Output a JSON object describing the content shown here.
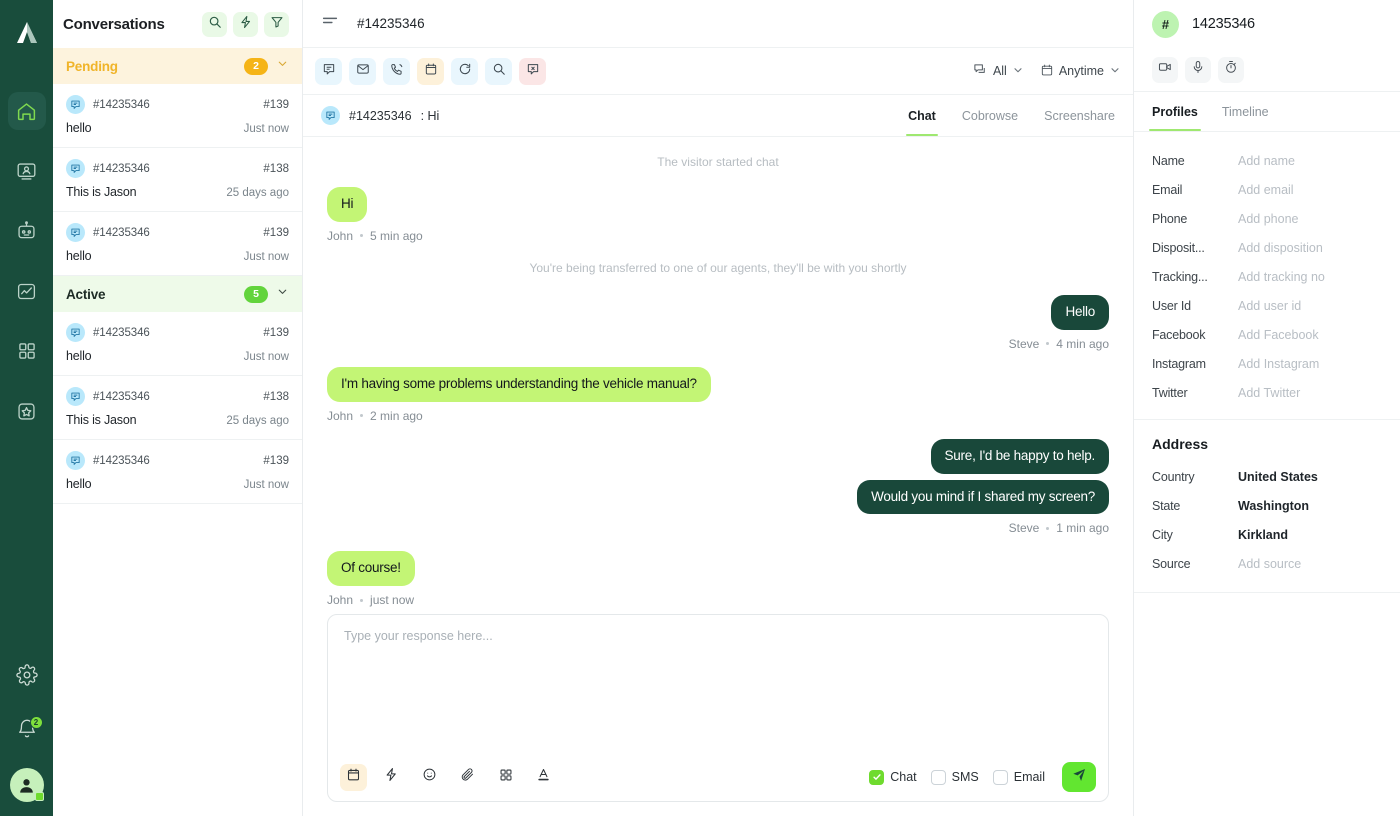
{
  "rail": {
    "logo_icon": "brand-logo-icon",
    "nav": [
      {
        "name": "home",
        "icon": "home-icon",
        "active": true
      },
      {
        "name": "visitors",
        "icon": "monitor-person-icon",
        "active": false
      },
      {
        "name": "bots",
        "icon": "robot-icon",
        "active": false
      },
      {
        "name": "analytics",
        "icon": "analytics-chart-icon",
        "active": false
      },
      {
        "name": "apps",
        "icon": "grid-apps-icon",
        "active": false
      },
      {
        "name": "favorites",
        "icon": "star-box-icon",
        "active": false
      }
    ],
    "bottom": [
      {
        "name": "settings",
        "icon": "gear-icon"
      },
      {
        "name": "notifications",
        "icon": "bell-icon",
        "badge": "2"
      },
      {
        "name": "profile",
        "icon": "user-avatar-icon"
      }
    ]
  },
  "conversations": {
    "title": "Conversations",
    "header_icons": [
      {
        "name": "search-icon"
      },
      {
        "name": "lightning-icon"
      },
      {
        "name": "filter-icon"
      }
    ],
    "groups": [
      {
        "label": "Pending",
        "count": "2",
        "items": [
          {
            "id": "#14235346",
            "number": "#139",
            "preview": "hello",
            "time": "Just now"
          },
          {
            "id": "#14235346",
            "number": "#138",
            "preview": "This is Jason",
            "time": "25 days ago"
          },
          {
            "id": "#14235346",
            "number": "#139",
            "preview": "hello",
            "time": "Just now"
          }
        ]
      },
      {
        "label": "Active",
        "count": "5",
        "items": [
          {
            "id": "#14235346",
            "number": "#139",
            "preview": "hello",
            "time": "Just now"
          },
          {
            "id": "#14235346",
            "number": "#138",
            "preview": "This is Jason",
            "time": "25 days ago"
          },
          {
            "id": "#14235346",
            "number": "#139",
            "preview": "hello",
            "time": "Just now"
          }
        ]
      }
    ]
  },
  "center": {
    "title": "#14235346",
    "tools": [
      {
        "name": "chat",
        "icon": "chat-bubble-icon",
        "bg": "#e8f6fd"
      },
      {
        "name": "email",
        "icon": "envelope-icon",
        "bg": "#e9f6fd"
      },
      {
        "name": "call",
        "icon": "phone-ring-icon",
        "bg": "#e9f6fd"
      },
      {
        "name": "schedule",
        "icon": "calendar-icon",
        "bg": "#fdf1da"
      },
      {
        "name": "refresh",
        "icon": "refresh-icon",
        "bg": "#e9f6fd"
      },
      {
        "name": "search",
        "icon": "search-icon",
        "bg": "#e9f6fd"
      },
      {
        "name": "closed",
        "icon": "closed-chat-icon",
        "bg": "#fbe6e6"
      }
    ],
    "filters": [
      {
        "name": "channel-filter",
        "label": "All",
        "icon": "chat-stack-icon"
      },
      {
        "name": "time-filter",
        "label": "Anytime",
        "icon": "calendar-icon"
      }
    ],
    "subject": {
      "id": "#14235346",
      "separator": ": Hi"
    },
    "tabs": [
      {
        "label": "Chat",
        "selected": true
      },
      {
        "label": "Cobrowse",
        "selected": false
      },
      {
        "label": "Screenshare",
        "selected": false
      }
    ],
    "messages": [
      {
        "kind": "system",
        "text": "The visitor started chat"
      },
      {
        "kind": "in",
        "lines": [
          "Hi"
        ],
        "author": "John",
        "time": "5 min ago"
      },
      {
        "kind": "system",
        "text": "You're being transferred to one of our agents, they'll be with you shortly"
      },
      {
        "kind": "out",
        "lines": [
          "Hello"
        ],
        "author": "Steve",
        "time": "4 min ago"
      },
      {
        "kind": "in",
        "lines": [
          "I'm having some problems understanding the vehicle manual?"
        ],
        "author": "John",
        "time": "2 min ago"
      },
      {
        "kind": "out",
        "lines": [
          "Sure, I'd be happy to help.",
          "Would you mind if I shared my screen?"
        ],
        "author": "Steve",
        "time": "1 min ago"
      },
      {
        "kind": "in",
        "lines": [
          "Of course!"
        ],
        "author": "John",
        "time": "just now"
      }
    ],
    "composer": {
      "placeholder": "Type your response here...",
      "tools": [
        {
          "name": "canned-calendar",
          "icon": "calendar-icon",
          "highlighted": true
        },
        {
          "name": "quick-reply",
          "icon": "lightning-icon",
          "highlighted": false
        },
        {
          "name": "emoji",
          "icon": "smiley-icon",
          "highlighted": false
        },
        {
          "name": "attach",
          "icon": "paperclip-icon",
          "highlighted": false
        },
        {
          "name": "apps",
          "icon": "grid-apps-icon",
          "highlighted": false
        },
        {
          "name": "text-format",
          "icon": "text-format-icon",
          "highlighted": false
        }
      ],
      "channels": [
        {
          "label": "Chat",
          "checked": true
        },
        {
          "label": "SMS",
          "checked": false
        },
        {
          "label": "Email",
          "checked": false
        }
      ],
      "send_icon": "send-paper-plane-icon"
    }
  },
  "right": {
    "hash": "#",
    "id": "14235346",
    "actions": [
      {
        "name": "video-call",
        "icon": "video-camera-icon"
      },
      {
        "name": "voice-call",
        "icon": "microphone-icon"
      },
      {
        "name": "timer",
        "icon": "stopwatch-icon"
      }
    ],
    "tabs": [
      {
        "label": "Profiles",
        "selected": true
      },
      {
        "label": "Timeline",
        "selected": false
      }
    ],
    "profile_fields": [
      {
        "key": "Name",
        "value": "Add name",
        "filled": false
      },
      {
        "key": "Email",
        "value": "Add email",
        "filled": false
      },
      {
        "key": "Phone",
        "value": "Add phone",
        "filled": false
      },
      {
        "key": "Disposit...",
        "value": "Add disposition",
        "filled": false
      },
      {
        "key": "Tracking...",
        "value": "Add tracking no",
        "filled": false
      },
      {
        "key": "User Id",
        "value": "Add user id",
        "filled": false
      },
      {
        "key": "Facebook",
        "value": "Add Facebook",
        "filled": false
      },
      {
        "key": "Instagram",
        "value": "Add Instagram",
        "filled": false
      },
      {
        "key": "Twitter",
        "value": "Add Twitter",
        "filled": false
      }
    ],
    "address_title": "Address",
    "address_fields": [
      {
        "key": "Country",
        "value": "United States",
        "filled": true
      },
      {
        "key": "State",
        "value": "Washington",
        "filled": true
      },
      {
        "key": "City",
        "value": "Kirkland",
        "filled": true
      },
      {
        "key": "Source",
        "value": "Add source",
        "filled": false
      }
    ]
  },
  "colors": {
    "rail_bg": "#194d3c",
    "accent_green": "#9fe870",
    "bubble_in": "#c3f575",
    "bubble_out": "#19483a",
    "pending_amber": "#f5b417",
    "active_green": "#62d43c",
    "send_green": "#62e630"
  }
}
